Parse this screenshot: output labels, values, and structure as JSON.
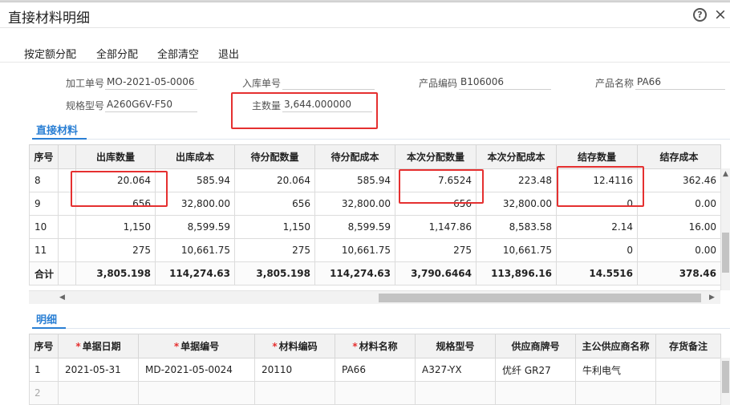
{
  "window": {
    "title": "直接材料明细",
    "help_icon": "?",
    "close_icon": "×"
  },
  "toolbar": {
    "quota_alloc": "按定额分配",
    "alloc_all": "全部分配",
    "clear_all": "全部清空",
    "exit": "退出"
  },
  "form": {
    "process_no": {
      "label": "加工单号",
      "value": "MO-2021-05-0006"
    },
    "inbound_no": {
      "label": "入库单号",
      "value": ""
    },
    "product_code": {
      "label": "产品编码",
      "value": "B106006"
    },
    "product_name": {
      "label": "产品名称",
      "value": "PA66"
    },
    "spec_model": {
      "label": "规格型号",
      "value": "A260G6V-F50"
    },
    "main_qty": {
      "label": "主数量",
      "value": "3,644.000000"
    }
  },
  "materials": {
    "tab_label": "直接材料",
    "headers": [
      "序号",
      "",
      "出库数量",
      "出库成本",
      "待分配数量",
      "待分配成本",
      "本次分配数量",
      "本次分配成本",
      "结存数量",
      "结存成本"
    ],
    "rows": [
      [
        "8",
        "",
        "20.064",
        "585.94",
        "20.064",
        "585.94",
        "7.6524",
        "223.48",
        "12.4116",
        "362.46"
      ],
      [
        "9",
        "",
        "656",
        "32,800.00",
        "656",
        "32,800.00",
        "656",
        "32,800.00",
        "0",
        "0.00"
      ],
      [
        "10",
        "",
        "1,150",
        "8,599.59",
        "1,150",
        "8,599.59",
        "1,147.86",
        "8,583.58",
        "2.14",
        "16.00"
      ],
      [
        "11",
        "",
        "275",
        "10,661.75",
        "275",
        "10,661.75",
        "275",
        "10,661.75",
        "0",
        "0.00"
      ]
    ],
    "total": [
      "合计",
      "",
      "3,805.198",
      "114,274.63",
      "3,805.198",
      "114,274.63",
      "3,790.6464",
      "113,896.16",
      "14.5516",
      "378.46"
    ]
  },
  "details": {
    "tab_label": "明细",
    "headers": [
      {
        "text": "序号",
        "required": false
      },
      {
        "text": "单据日期",
        "required": true
      },
      {
        "text": "单据编号",
        "required": true
      },
      {
        "text": "材料编码",
        "required": true
      },
      {
        "text": "材料名称",
        "required": true
      },
      {
        "text": "规格型号",
        "required": false
      },
      {
        "text": "供应商牌号",
        "required": false
      },
      {
        "text": "主公供应商名称",
        "required": false
      },
      {
        "text": "存货备注",
        "required": false
      }
    ],
    "rows": [
      [
        "1",
        "2021-05-31",
        "MD-2021-05-0024",
        "20110",
        "PA66",
        "A327-YX",
        "优纤 GR27",
        "牛利电气",
        ""
      ],
      [
        "2",
        "",
        "",
        "",
        "",
        "",
        "",
        "",
        ""
      ]
    ]
  },
  "colors": {
    "accent": "#2a7fd4",
    "highlight_box": "#e53030"
  }
}
